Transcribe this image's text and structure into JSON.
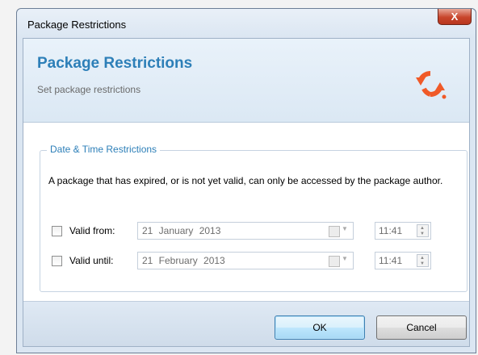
{
  "window": {
    "title": "Package Restrictions",
    "close_label": "X"
  },
  "header": {
    "title": "Package Restrictions",
    "subtitle": "Set package restrictions"
  },
  "group": {
    "legend": "Date & Time Restrictions",
    "info": "A package that has expired, or is not yet valid, can only be accessed by the package author."
  },
  "valid_from": {
    "label": "Valid from:",
    "checked": false,
    "date": "21 January 2013",
    "time": "11:41"
  },
  "valid_until": {
    "label": "Valid until:",
    "checked": false,
    "date": "21 February 2013",
    "time": "11:41"
  },
  "buttons": {
    "ok": "OK",
    "cancel": "Cancel"
  },
  "colors": {
    "accent": "#2d7fb8",
    "logo": "#f05a28"
  },
  "icons": {
    "logo": "sync-arrows-icon",
    "calendar": "calendar-icon",
    "close": "close-icon"
  }
}
